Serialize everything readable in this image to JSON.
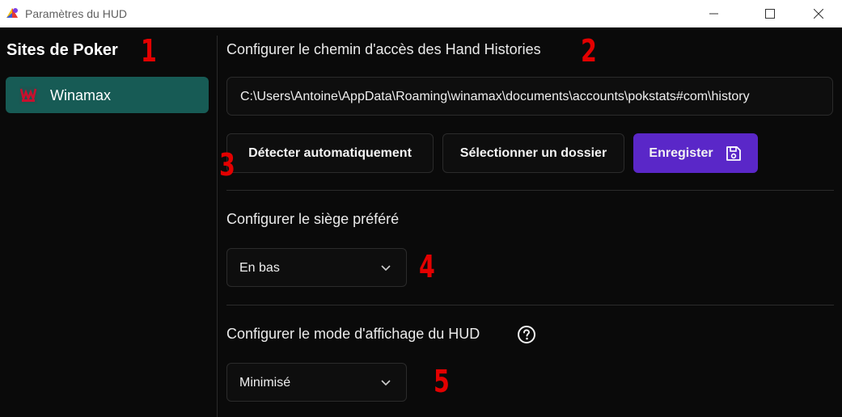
{
  "window": {
    "title": "Paramètres du HUD"
  },
  "sidebar": {
    "title": "Sites de Poker",
    "items": [
      {
        "label": "Winamax",
        "icon": "winamax-logo"
      }
    ]
  },
  "hand_histories": {
    "title": "Configurer le chemin d'accès des Hand Histories",
    "path_value": "C:\\Users\\Antoine\\AppData\\Roaming\\winamax\\documents\\accounts\\pokstats#com\\history",
    "detect_label": "Détecter automatiquement",
    "select_folder_label": "Sélectionner un dossier",
    "save_label": "Enregister",
    "save_icon": "floppy-disk-icon"
  },
  "preferred_seat": {
    "title": "Configurer le siège préféré",
    "selected": "En bas"
  },
  "display_mode": {
    "title": "Configurer le mode d'affichage du HUD",
    "selected": "Minimisé",
    "help_icon": "question-circle-icon"
  },
  "annotations": [
    "1",
    "2",
    "3",
    "4",
    "5"
  ],
  "colors": {
    "background": "#0a0a0a",
    "sidebar_active": "#175b55",
    "primary_button": "#5a27c8",
    "annotation": "#e30000"
  }
}
